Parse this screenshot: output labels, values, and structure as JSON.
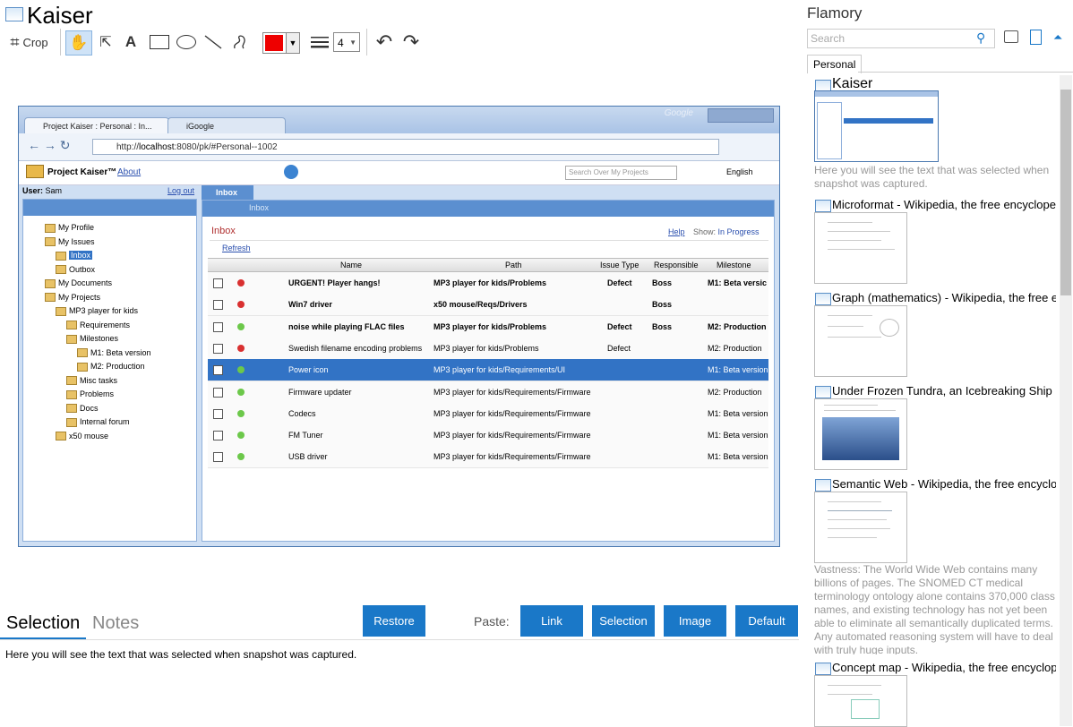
{
  "app": {
    "title": "Kaiser"
  },
  "toolbar": {
    "crop_label": "Crop",
    "text_tool": "A",
    "line_width": "4"
  },
  "snapshot": {
    "tabs": [
      "Project Kaiser : Personal : In...",
      "iGoogle"
    ],
    "url_plain": "http://",
    "url_host": "localhost",
    "url_rest": ":8080/pk/#Personal--1002",
    "chrome_brand": "Google",
    "app_name": "Project Kaiser™",
    "about": "About",
    "search_placeholder": "Search Over My Projects",
    "language": "English",
    "user_label": "User:",
    "user_name": "Sam",
    "logout": "Log out",
    "inbox_tab": "Inbox",
    "crumb": "Inbox",
    "panel_title": "Inbox",
    "help": "Help",
    "show_label": "Show:",
    "show_value": "In Progress",
    "refresh": "Refresh",
    "tree": [
      "My Profile",
      "My Issues",
      "Inbox",
      "Outbox",
      "My Documents",
      "My Projects",
      "MP3 player for kids",
      "Requirements",
      "Milestones",
      "M1: Beta version",
      "M2: Production",
      "Misc tasks",
      "Problems",
      "Docs",
      "Internal forum",
      "x50 mouse"
    ],
    "columns": [
      "Name",
      "Path",
      "Issue Type",
      "Responsible",
      "Milestone"
    ],
    "rows": [
      {
        "name": "URGENT! Player hangs!",
        "path": "MP3 player for kids/Problems",
        "type": "Defect",
        "resp": "Boss",
        "ms": "M1: Beta versic",
        "bold": true,
        "status": "red"
      },
      {
        "name": "Win7 driver",
        "path": "x50 mouse/Reqs/Drivers",
        "type": "",
        "resp": "Boss",
        "ms": "",
        "bold": true,
        "status": "red"
      },
      {
        "name": "noise while playing FLAC files",
        "path": "MP3 player for kids/Problems",
        "type": "Defect",
        "resp": "Boss",
        "ms": "M2: Production",
        "bold": true,
        "status": "green"
      },
      {
        "name": "Swedish filename encoding problems",
        "path": "MP3 player for kids/Problems",
        "type": "Defect",
        "resp": "",
        "ms": "M2: Production",
        "bold": false,
        "status": "red"
      },
      {
        "name": "Power icon",
        "path": "MP3 player for kids/Requirements/UI",
        "type": "",
        "resp": "",
        "ms": "M1: Beta version",
        "bold": false,
        "status": "green"
      },
      {
        "name": "Firmware updater",
        "path": "MP3 player for kids/Requirements/Firmware",
        "type": "",
        "resp": "",
        "ms": "M2: Production",
        "bold": false,
        "status": "green"
      },
      {
        "name": "Codecs",
        "path": "MP3 player for kids/Requirements/Firmware",
        "type": "",
        "resp": "",
        "ms": "M1: Beta version",
        "bold": false,
        "status": "green"
      },
      {
        "name": "FM Tuner",
        "path": "MP3 player for kids/Requirements/Firmware",
        "type": "",
        "resp": "",
        "ms": "M1: Beta version",
        "bold": false,
        "status": "green"
      },
      {
        "name": "USB driver",
        "path": "MP3 player for kids/Requirements/Firmware",
        "type": "",
        "resp": "",
        "ms": "M1: Beta version",
        "bold": false,
        "status": "green"
      }
    ]
  },
  "bottom": {
    "tab_selection": "Selection",
    "tab_notes": "Notes",
    "restore": "Restore",
    "paste_label": "Paste:",
    "paste_link": "Link",
    "paste_selection": "Selection",
    "paste_image": "Image",
    "paste_default": "Default",
    "selection_text": "Here you will see the text that was selected when snapshot was captured."
  },
  "right_panel": {
    "title": "Flamory",
    "search_placeholder": "Search",
    "tab": "Personal",
    "entries": [
      {
        "title": "Kaiser",
        "desc": "Here you will see the text that was selected when snapshot was captured."
      },
      {
        "title": "Microformat - Wikipedia, the free encyclopedia"
      },
      {
        "title": "Graph (mathematics) - Wikipedia, the free ency"
      },
      {
        "title": "Under Frozen Tundra, an Icebreaking Ship Unco"
      },
      {
        "title": "Semantic Web - Wikipedia, the free encycloped",
        "desc": "Vastness: The World Wide Web contains many billions of pages. The SNOMED CT medical terminology ontology alone contains 370,000 class names, and existing technology has not yet been able to eliminate all semantically duplicated terms. Any automated reasoning system will have to deal with truly huge inputs."
      },
      {
        "title": "Concept map - Wikipedia, the free encyclopedia"
      }
    ]
  },
  "colors": {
    "accent": "#1a78c8",
    "pen": "#ee0000",
    "selected_row": "#3273c5"
  }
}
